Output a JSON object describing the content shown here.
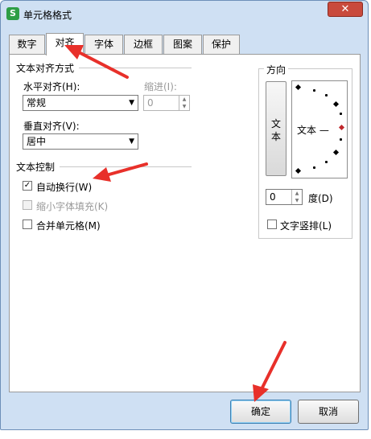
{
  "window": {
    "title": "单元格格式",
    "icon_letter": "S",
    "close_glyph": "✕"
  },
  "tabs": [
    {
      "label": "数字"
    },
    {
      "label": "对齐",
      "active": true
    },
    {
      "label": "字体"
    },
    {
      "label": "边框"
    },
    {
      "label": "图案"
    },
    {
      "label": "保护"
    }
  ],
  "alignment": {
    "section_title": "文本对齐方式",
    "horizontal_label": "水平对齐(H):",
    "horizontal_value": "常规",
    "indent_label": "缩进(I):",
    "indent_value": "0",
    "vertical_label": "垂直对齐(V):",
    "vertical_value": "居中"
  },
  "text_control": {
    "section_title": "文本控制",
    "wrap_text": {
      "label": "自动换行(W)",
      "checked": true
    },
    "shrink_to_fit": {
      "label": "缩小字体填充(K)",
      "checked": false,
      "disabled": true
    },
    "merge_cells": {
      "label": "合并单元格(M)",
      "checked": false
    }
  },
  "orientation": {
    "section_title": "方向",
    "vertical_text_button": [
      "文",
      "本"
    ],
    "dial_text": "文本 —",
    "degrees_value": "0",
    "degrees_label": "度(D)",
    "stacked_text_label": "文字竖排(L)"
  },
  "footer": {
    "ok_label": "确定",
    "cancel_label": "取消"
  },
  "colors": {
    "window_bg": "#cfe0f3",
    "close_button": "#c94a3c",
    "annotation_arrow": "#e8302a",
    "dial_marker": "#c0282d"
  }
}
